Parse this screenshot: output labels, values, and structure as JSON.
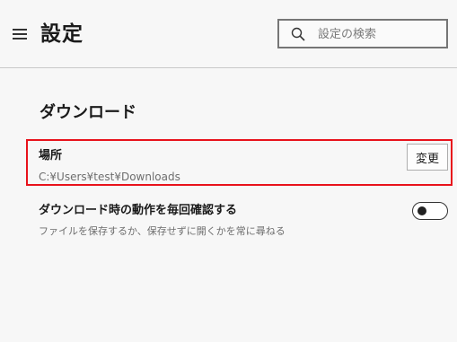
{
  "header": {
    "title": "設定",
    "menu_icon": "hamburger-menu-icon",
    "search": {
      "placeholder": "設定の検索",
      "value": "",
      "icon": "search-icon"
    }
  },
  "downloads": {
    "section_title": "ダウンロード",
    "location": {
      "label": "場所",
      "path": "C:¥Users¥test¥Downloads",
      "change_button_label": "変更",
      "highlight_color": "#e8121b"
    },
    "ask_where_to_save": {
      "label": "ダウンロード時の動作を毎回確認する",
      "description": "ファイルを保存するか、保存せずに開くかを常に尋ねる",
      "enabled": false
    }
  }
}
